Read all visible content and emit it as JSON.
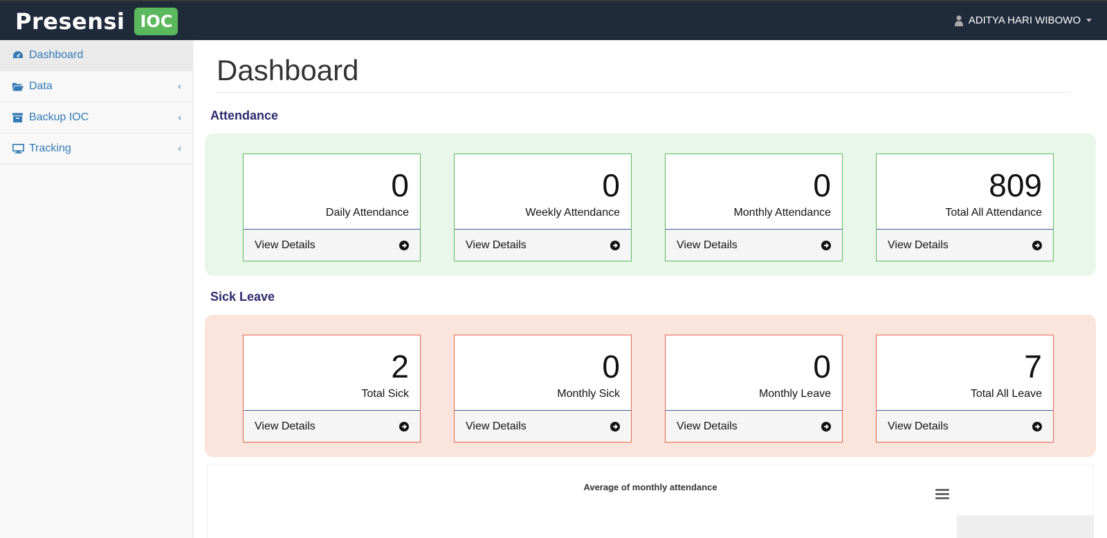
{
  "brand": {
    "name": "Presensi",
    "badge": "IOC"
  },
  "user": {
    "name": "ADITYA HARI WIBOWO"
  },
  "sidebar": {
    "items": [
      {
        "label": "Dashboard"
      },
      {
        "label": "Data"
      },
      {
        "label": "Backup IOC"
      },
      {
        "label": "Tracking"
      }
    ]
  },
  "page": {
    "title": "Dashboard"
  },
  "attendance": {
    "title": "Attendance",
    "cards": [
      {
        "value": "0",
        "label": "Daily Attendance",
        "link": "View Details"
      },
      {
        "value": "0",
        "label": "Weekly Attendance",
        "link": "View Details"
      },
      {
        "value": "0",
        "label": "Monthly Attendance",
        "link": "View Details"
      },
      {
        "value": "809",
        "label": "Total All Attendance",
        "link": "View Details"
      }
    ]
  },
  "sick_leave": {
    "title": "Sick Leave",
    "cards": [
      {
        "value": "2",
        "label": "Total Sick",
        "link": "View Details"
      },
      {
        "value": "0",
        "label": "Monthly Sick",
        "link": "View Details"
      },
      {
        "value": "0",
        "label": "Monthly Leave",
        "link": "View Details"
      },
      {
        "value": "7",
        "label": "Total All Leave",
        "link": "View Details"
      }
    ]
  },
  "chart": {
    "title": "Average of monthly attendance"
  },
  "colors": {
    "topbar": "#1f2a3a",
    "brand_badge": "#5cb85c",
    "link": "#337ab7",
    "attendance_border": "#5cb85c",
    "sick_border": "#e2664b",
    "section_title": "#2d2a6e"
  }
}
